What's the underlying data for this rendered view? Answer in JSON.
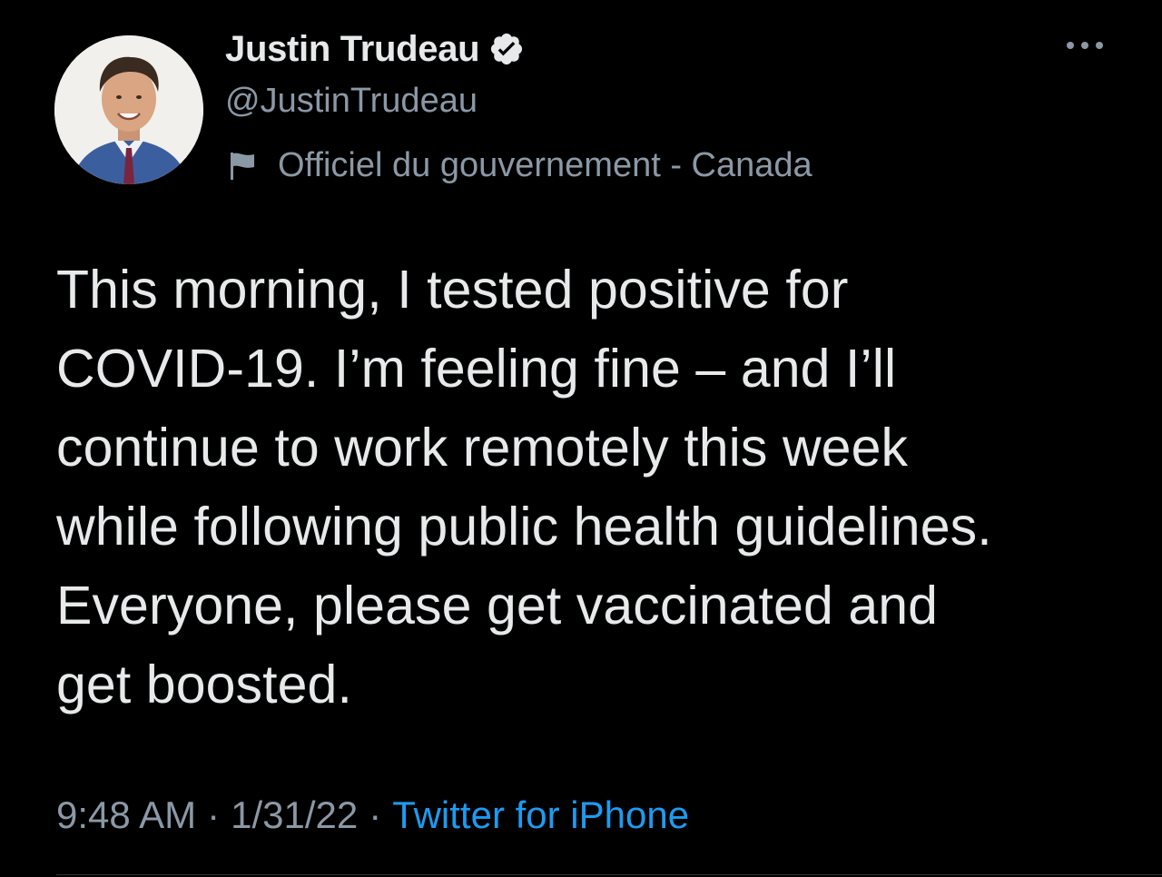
{
  "author": {
    "display_name": "Justin Trudeau",
    "handle": "@JustinTrudeau",
    "label": "Officiel du gouvernement - Canada",
    "verified": true
  },
  "tweet": {
    "text": "This morning, I tested positive for\nCOVID-19. I’m feeling fine – and I’ll\ncontinue to work remotely this week\nwhile following public health guidelines.\nEveryone, please get vaccinated and\nget boosted.",
    "time": "9:48 AM",
    "date": "1/31/22",
    "separator": "·",
    "source": "Twitter for iPhone"
  },
  "icons": {
    "verified": "verified-badge-icon",
    "flag": "flag-icon",
    "more": "more-horizontal-icon"
  },
  "colors": {
    "background": "#000000",
    "text_primary": "#e7e9ea",
    "text_secondary": "#8b98a5",
    "link": "#1d9bf0"
  }
}
